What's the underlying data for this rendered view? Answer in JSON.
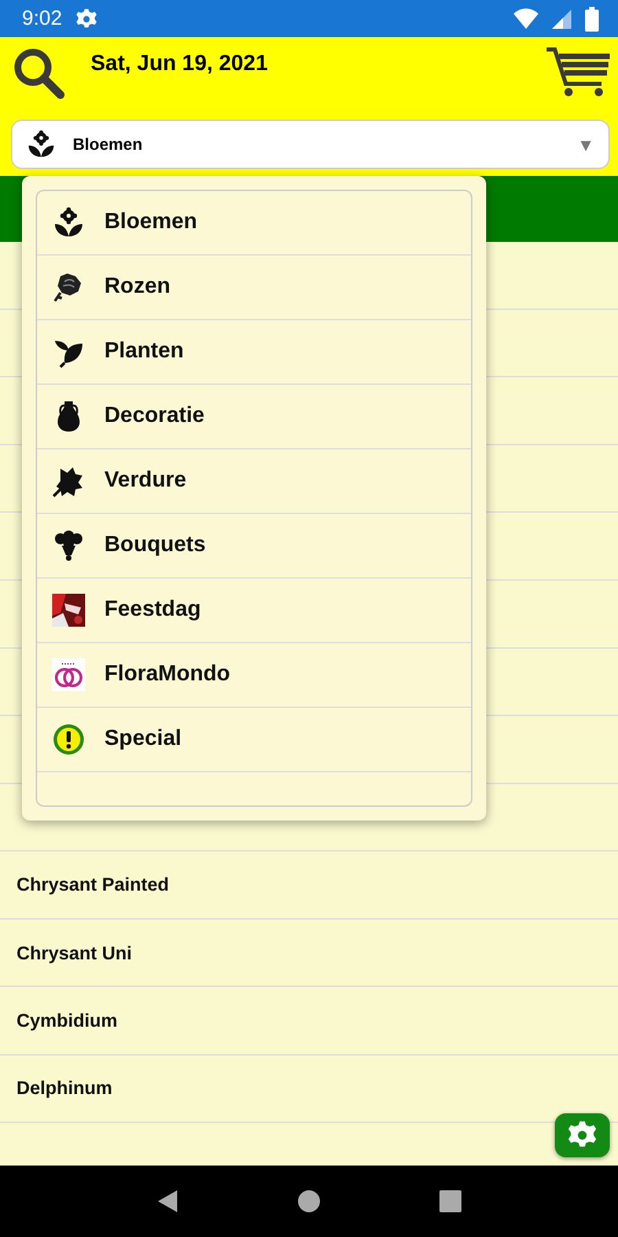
{
  "status_bar": {
    "time": "9:02"
  },
  "header": {
    "date": "Sat, Jun 19, 2021"
  },
  "category_select": {
    "value": "Bloemen",
    "kind": "flower",
    "arrow": "▼"
  },
  "list": [
    {
      "label": "Chrysant Painted"
    },
    {
      "label": "Chrysant Uni"
    },
    {
      "label": "Cymbidium"
    },
    {
      "label": "Delphinum"
    }
  ],
  "menu": [
    {
      "label": "Bloemen",
      "kind": "flower"
    },
    {
      "label": "Rozen",
      "kind": "rose"
    },
    {
      "label": "Planten",
      "kind": "leaves"
    },
    {
      "label": "Decoratie",
      "kind": "vase"
    },
    {
      "label": "Verdure",
      "kind": "leaf"
    },
    {
      "label": "Bouquets",
      "kind": "bouquet"
    },
    {
      "label": "Feestdag",
      "kind": "photo"
    },
    {
      "label": "FloraMondo",
      "kind": "rings"
    },
    {
      "label": "Special",
      "kind": "badge"
    }
  ]
}
